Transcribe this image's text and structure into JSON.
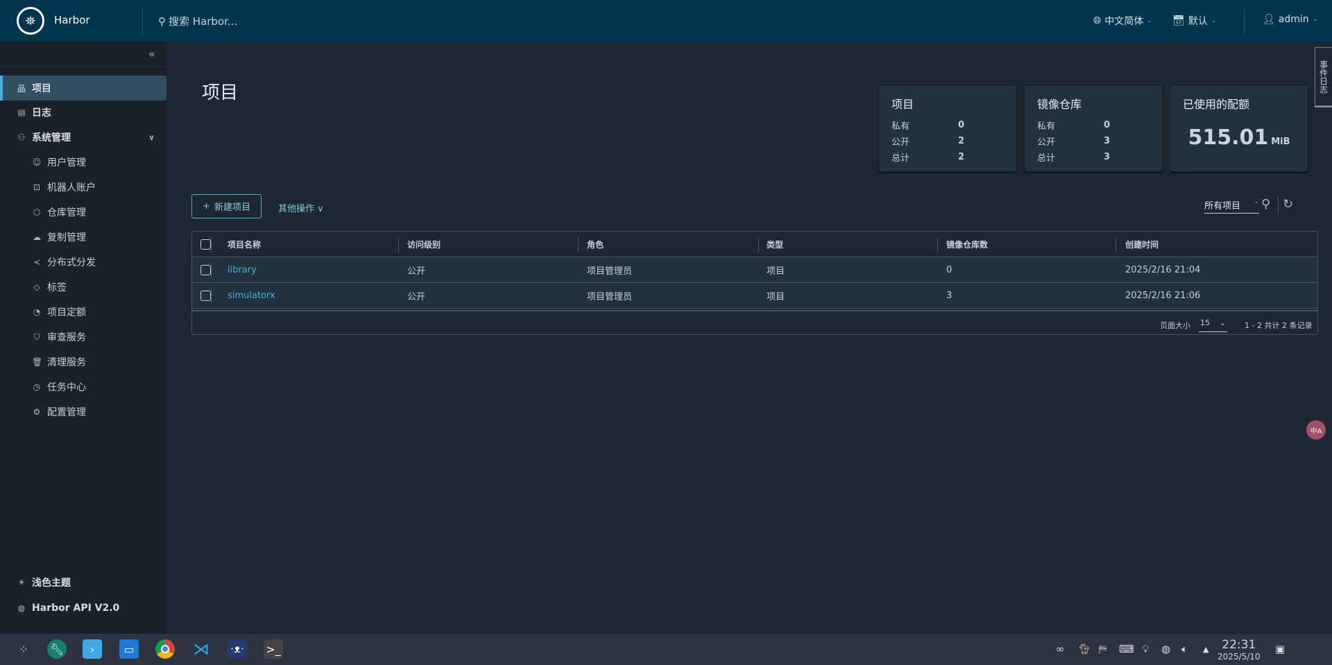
{
  "header": {
    "brand": "Harbor",
    "search_placeholder": "搜索 Harbor...",
    "language": "中文简体",
    "datetime_format": "默认",
    "user": "admin"
  },
  "sidebar": {
    "items": [
      {
        "label": "项目",
        "icon": "projects-icon"
      },
      {
        "label": "日志",
        "icon": "logs-icon"
      },
      {
        "label": "系统管理",
        "icon": "admin-icon"
      }
    ],
    "sub_items": [
      {
        "label": "用户管理",
        "icon": "users-icon"
      },
      {
        "label": "机器人账户",
        "icon": "robot-icon"
      },
      {
        "label": "仓库管理",
        "icon": "box-icon"
      },
      {
        "label": "复制管理",
        "icon": "cloud-icon"
      },
      {
        "label": "分布式分发",
        "icon": "share-icon"
      },
      {
        "label": "标签",
        "icon": "tag-icon"
      },
      {
        "label": "项目定额",
        "icon": "quota-icon"
      },
      {
        "label": "审查服务",
        "icon": "shield-icon"
      },
      {
        "label": "清理服务",
        "icon": "trash-icon"
      },
      {
        "label": "任务中心",
        "icon": "dashboard-icon"
      },
      {
        "label": "配置管理",
        "icon": "gear-icon"
      }
    ],
    "theme": "浅色主题",
    "api": "Harbor API V2.0"
  },
  "main": {
    "title": "项目",
    "cards": {
      "projects": {
        "title": "项目",
        "rows": [
          {
            "label": "私有",
            "value": "0"
          },
          {
            "label": "公开",
            "value": "2"
          },
          {
            "label": "总计",
            "value": "2"
          }
        ]
      },
      "repos": {
        "title": "镜像仓库",
        "rows": [
          {
            "label": "私有",
            "value": "0"
          },
          {
            "label": "公开",
            "value": "3"
          },
          {
            "label": "总计",
            "value": "3"
          }
        ]
      },
      "quota": {
        "title": "已使用的配额",
        "value": "515.01",
        "unit": "MiB"
      }
    },
    "new_project": "新建项目",
    "other_actions": "其他操作",
    "filter": "所有项目",
    "table": {
      "columns": [
        "项目名称",
        "访问级别",
        "角色",
        "类型",
        "镜像仓库数",
        "创建时间"
      ],
      "rows": [
        [
          "library",
          "公开",
          "项目管理员",
          "项目",
          "0",
          "2025/2/16 21:04"
        ],
        [
          "simulatorx",
          "公开",
          "项目管理员",
          "项目",
          "3",
          "2025/2/16 21:06"
        ]
      ],
      "page_size_label": "页面大小",
      "page_size": "15",
      "summary": "1 - 2 共计 2 条记录"
    },
    "event_log": "事件日志",
    "translate": "中A"
  },
  "taskbar": {
    "time": "22:31",
    "date": "2025/5/10"
  },
  "colors": {
    "header": "#00364d",
    "accent": "#49afd9",
    "sidebar": "#1a2229",
    "main": "#1c2731"
  }
}
